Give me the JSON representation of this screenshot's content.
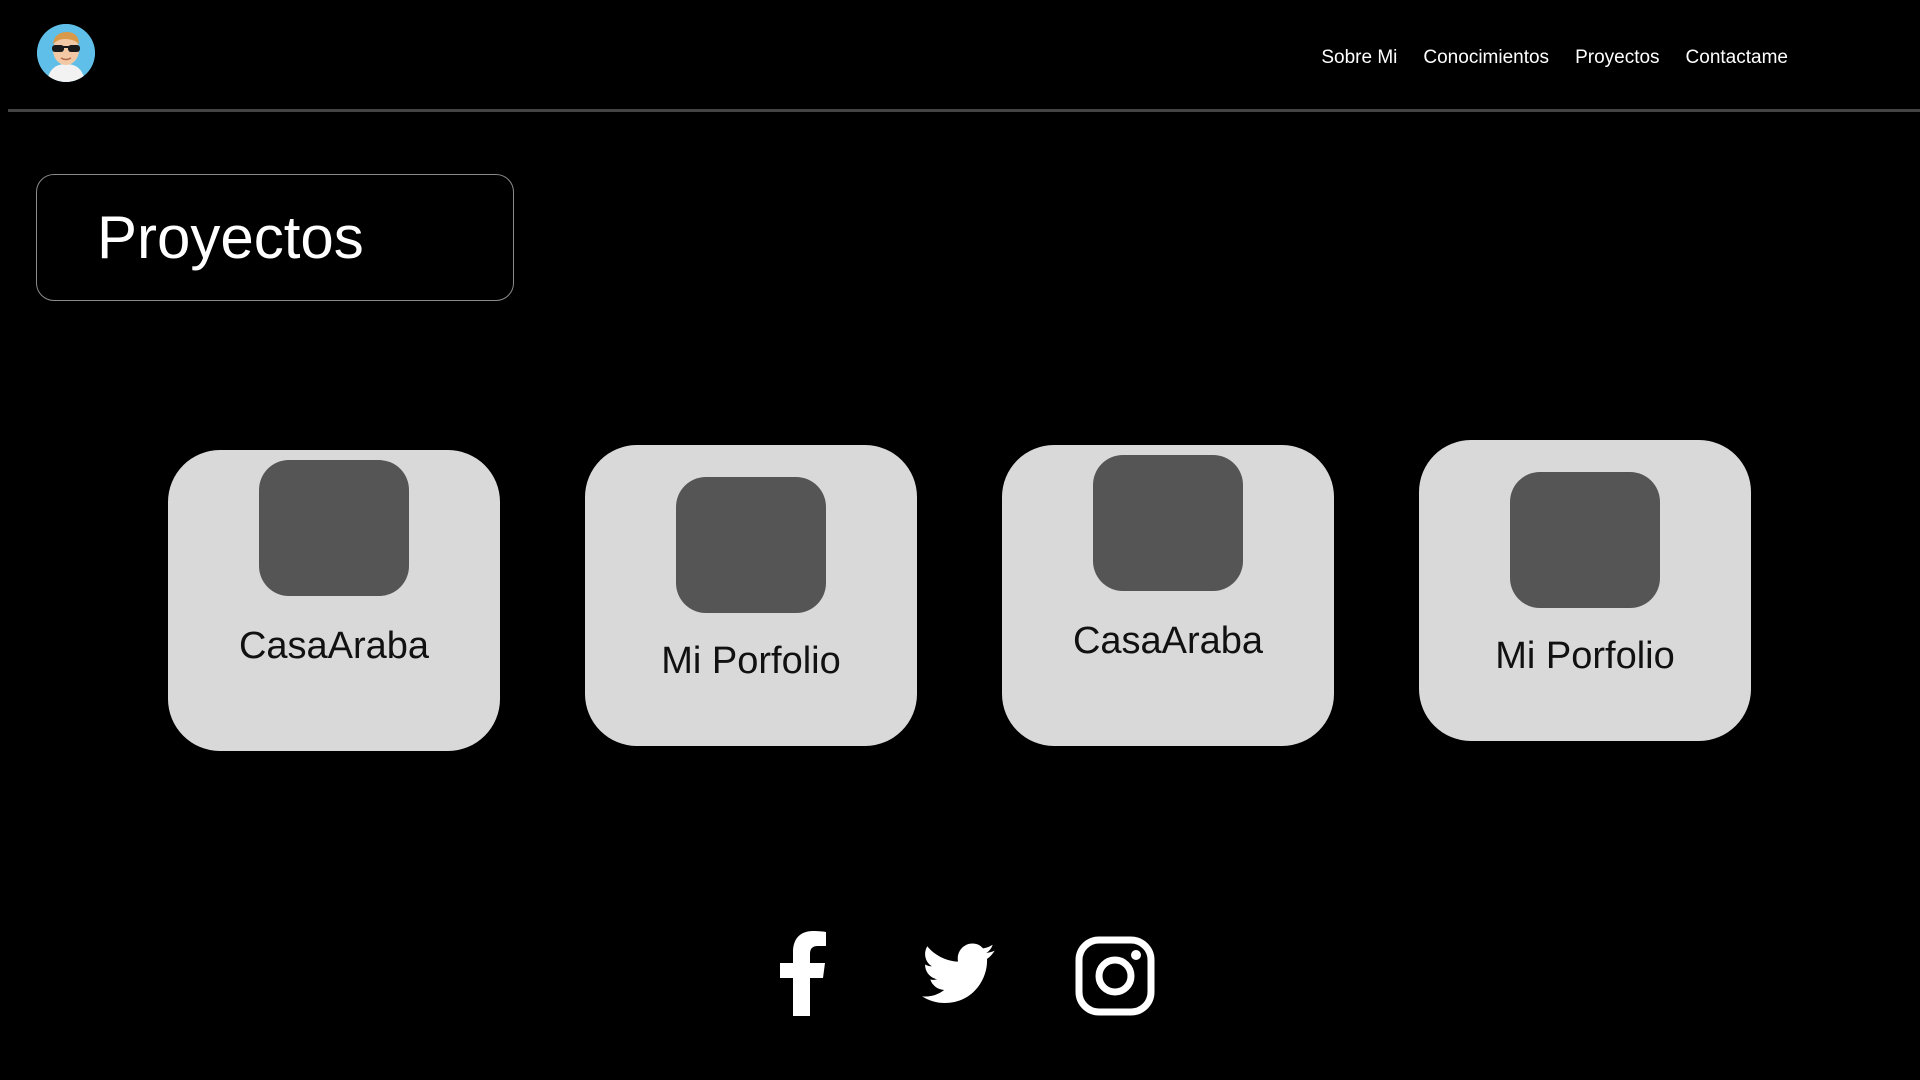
{
  "header": {
    "avatar_icon": "avatar-with-sunglasses",
    "nav": [
      {
        "label": "Sobre Mi"
      },
      {
        "label": "Conocimientos"
      },
      {
        "label": "Proyectos"
      },
      {
        "label": "Contactame"
      }
    ]
  },
  "section": {
    "title": "Proyectos"
  },
  "projects": [
    {
      "name": "CasaAraba"
    },
    {
      "name": "Mi Porfolio"
    },
    {
      "name": "CasaAraba"
    },
    {
      "name": "Mi Porfolio"
    }
  ],
  "social": [
    {
      "icon": "facebook-icon"
    },
    {
      "icon": "twitter-icon"
    },
    {
      "icon": "instagram-icon"
    }
  ],
  "colors": {
    "background": "#000000",
    "card": "#d9d9d9",
    "thumb": "#555555",
    "text": "#ffffff"
  }
}
